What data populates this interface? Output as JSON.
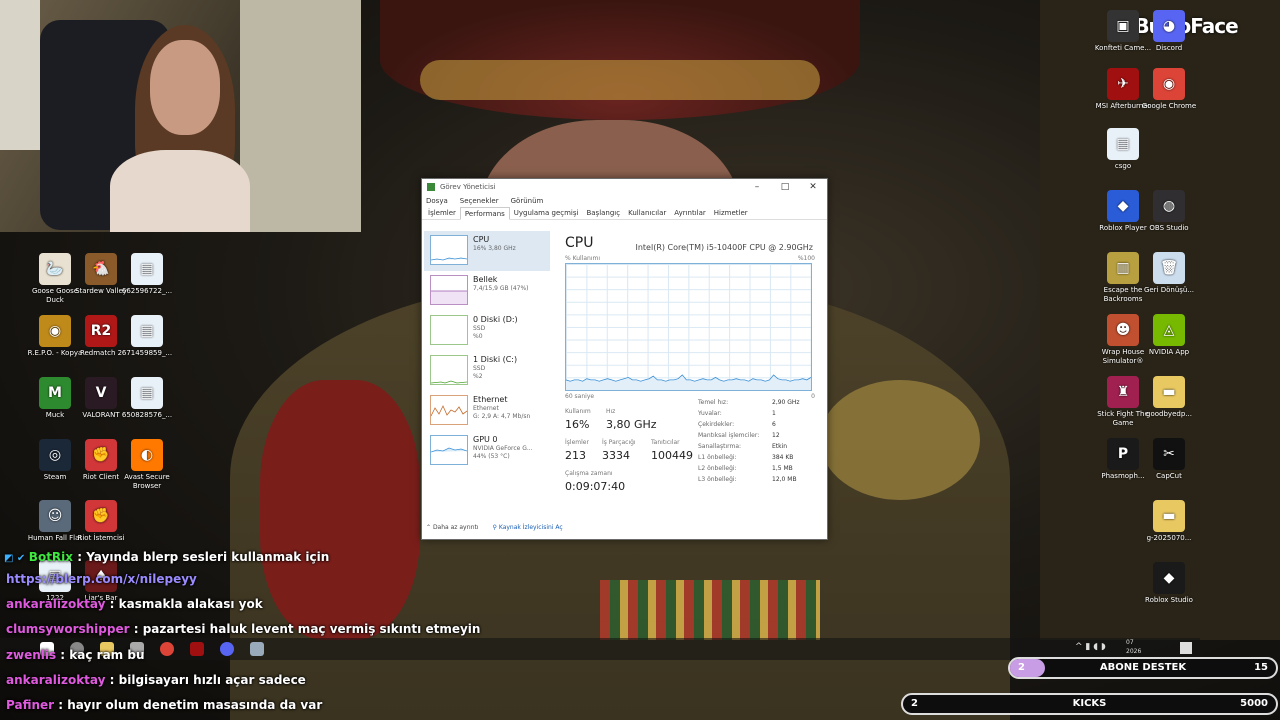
{
  "brand": {
    "name": "BuNoFace"
  },
  "desktop_left": [
    {
      "label": "Goose Goose Duck",
      "icon": "goose-icon",
      "color": "#e8e0d0",
      "glyph": "🦢"
    },
    {
      "label": "Stardew Valley",
      "icon": "stardew-icon",
      "color": "#8a5a2a",
      "glyph": "🐔"
    },
    {
      "label": "662596722_...",
      "icon": "file-icon",
      "color": "#e8f0f8",
      "glyph": "▤"
    },
    {
      "label": "R.E.P.O. - Kopya",
      "icon": "repo-icon",
      "color": "#c08a1a",
      "glyph": "◉"
    },
    {
      "label": "Redmatch 2",
      "icon": "redmatch-icon",
      "color": "#b01818",
      "glyph": "R2"
    },
    {
      "label": "671459859_...",
      "icon": "file-icon",
      "color": "#e8f0f8",
      "glyph": "▤"
    },
    {
      "label": "Muck",
      "icon": "muck-icon",
      "color": "#2e8a2e",
      "glyph": "M"
    },
    {
      "label": "VALORANT",
      "icon": "valorant-icon",
      "color": "#2a1a24",
      "glyph": "V"
    },
    {
      "label": "650828576_...",
      "icon": "file-icon",
      "color": "#e8f0f8",
      "glyph": "▤"
    },
    {
      "label": "Steam",
      "icon": "steam-icon",
      "color": "#1b2838",
      "glyph": "◎"
    },
    {
      "label": "Riot Client",
      "icon": "riot-icon",
      "color": "#d13639",
      "glyph": "✊"
    },
    {
      "label": "Avast Secure Browser",
      "icon": "avast-icon",
      "color": "#ff7800",
      "glyph": "◐"
    },
    {
      "label": "Human Fall Flat",
      "icon": "humanfallflat-icon",
      "color": "#5a6a7a",
      "glyph": "☺"
    },
    {
      "label": "Riot İstemcisi",
      "icon": "riot-icon",
      "color": "#d13639",
      "glyph": "✊"
    },
    {
      "label": "1222",
      "icon": "file-icon",
      "color": "#e8f0f8",
      "glyph": "▤"
    },
    {
      "label": "Liar's Bar",
      "icon": "liarsbar-icon",
      "color": "#6a1a1a",
      "glyph": "♠"
    }
  ],
  "desktop_right": [
    {
      "label": "Konfteti Came...",
      "icon": "camera-icon",
      "color": "#333",
      "glyph": "▣"
    },
    {
      "label": "Discord",
      "icon": "discord-icon",
      "color": "#5865f2",
      "glyph": "◕"
    },
    {
      "label": "MSI Afterburner",
      "icon": "msi-icon",
      "color": "#a01010",
      "glyph": "✈"
    },
    {
      "label": "Google Chrome",
      "icon": "chrome-icon",
      "color": "#db4437",
      "glyph": "◉"
    },
    {
      "label": "csgo",
      "icon": "file-icon",
      "color": "#e8f0f8",
      "glyph": "▤"
    },
    {
      "label": "Roblox Player",
      "icon": "roblox-icon",
      "color": "#2a5cd8",
      "glyph": "◆"
    },
    {
      "label": "OBS Studio",
      "icon": "obs-icon",
      "color": "#302e31",
      "glyph": "◍"
    },
    {
      "label": "Escape the Backrooms",
      "icon": "backrooms-icon",
      "color": "#b8a040",
      "glyph": "▥"
    },
    {
      "label": "Geri Dönüşü...",
      "icon": "recycle-bin-icon",
      "color": "#cde",
      "glyph": "🗑"
    },
    {
      "label": "Wrap House Simulator®",
      "icon": "wraphouse-icon",
      "color": "#c05030",
      "glyph": "☻"
    },
    {
      "label": "NVIDIA App",
      "icon": "nvidia-icon",
      "color": "#76b900",
      "glyph": "◬"
    },
    {
      "label": "Stick Fight The Game",
      "icon": "stickfight-icon",
      "color": "#a02050",
      "glyph": "♜"
    },
    {
      "label": "goodbyedp...",
      "icon": "folder-icon",
      "color": "#e8c860",
      "glyph": "▬"
    },
    {
      "label": "Phasmoph...",
      "icon": "phasmophobia-icon",
      "color": "#1a1a1a",
      "glyph": "P"
    },
    {
      "label": "CapCut",
      "icon": "capcut-icon",
      "color": "#111",
      "glyph": "✂"
    },
    {
      "label": "g-2025070...",
      "icon": "folder-icon",
      "color": "#e8c860",
      "glyph": "▬"
    },
    {
      "label": "Roblox Studio",
      "icon": "roblox-studio-icon",
      "color": "#1a1a1a",
      "glyph": "◆"
    }
  ],
  "taskmgr": {
    "title": "Görev Yöneticisi",
    "menu": [
      "Dosya",
      "Seçenekler",
      "Görünüm"
    ],
    "tabs": [
      "İşlemler",
      "Performans",
      "Uygulama geçmişi",
      "Başlangıç",
      "Kullanıcılar",
      "Ayrıntılar",
      "Hizmetler"
    ],
    "active_tab": "Performans",
    "sidebar": [
      {
        "name": "CPU",
        "line2": "16% 3,80 GHz",
        "line3": ""
      },
      {
        "name": "Bellek",
        "line2": "7,4/15,9 GB (47%)",
        "line3": ""
      },
      {
        "name": "0 Diski (D:)",
        "line2": "SSD",
        "line3": "%0"
      },
      {
        "name": "1 Diski (C:)",
        "line2": "SSD",
        "line3": "%2"
      },
      {
        "name": "Ethernet",
        "line2": "Ethernet",
        "line3": "G: 2,9 A: 4,7 Mb/sn"
      },
      {
        "name": "GPU 0",
        "line2": "NVIDIA GeForce G...",
        "line3": "44% (53 °C)"
      }
    ],
    "main": {
      "heading": "CPU",
      "model": "Intel(R) Core(TM) i5-10400F CPU @ 2.90GHz",
      "graph_top_left": "% Kullanımı",
      "graph_top_right": "%100",
      "graph_bottom_left": "60 saniye",
      "graph_bottom_right": "0",
      "usage_series": [
        8,
        7,
        8,
        8,
        7,
        9,
        8,
        8,
        7,
        8,
        9,
        8,
        7,
        8,
        9,
        10,
        8,
        8,
        7,
        8,
        9,
        11,
        8,
        8,
        7,
        8,
        8,
        9,
        12,
        8,
        8,
        7,
        8,
        9,
        8,
        8,
        10,
        8,
        7,
        8,
        8,
        9,
        8,
        8,
        7,
        9,
        8,
        8,
        7,
        8,
        12,
        9,
        8,
        8,
        7,
        8,
        8,
        9,
        8,
        10
      ],
      "stats": {
        "usage_label": "Kullanım",
        "usage": "16%",
        "speed_label": "Hız",
        "speed": "3,80 GHz",
        "processes_label": "İşlemler",
        "processes": "213",
        "threads_label": "İş Parçacığı",
        "threads": "3334",
        "handles_label": "Tanıtıcılar",
        "handles": "100449",
        "uptime_label": "Çalışma zamanı",
        "uptime": "0:09:07:40"
      },
      "specs": [
        {
          "k": "Temel hız:",
          "v": "2,90 GHz"
        },
        {
          "k": "Yuvalar:",
          "v": "1"
        },
        {
          "k": "Çekirdekler:",
          "v": "6"
        },
        {
          "k": "Mantıksal işlemciler:",
          "v": "12"
        },
        {
          "k": "Sanallaştırma:",
          "v": "Etkin"
        },
        {
          "k": "L1 önbelleği:",
          "v": "384 KB"
        },
        {
          "k": "L2 önbelleği:",
          "v": "1,5 MB"
        },
        {
          "k": "L3 önbelleği:",
          "v": "12,0 MB"
        }
      ]
    },
    "footer": {
      "less": "Daha az ayrıntı",
      "monitor": "Kaynak İzleyicisini Aç"
    }
  },
  "chat": [
    {
      "user": "BotRix",
      "color": "#3ee83e",
      "sep": " : ",
      "msg": "Yayında blerp sesleri kullanmak için"
    },
    {
      "user": "",
      "color": "#9a8cff",
      "sep": "",
      "msg": "https://blerp.com/x/nilepeyy",
      "link": true
    },
    {
      "user": "ankaralizoktay",
      "color": "#e05adf",
      "sep": " : ",
      "msg": "kasmakla alakası yok"
    },
    {
      "user": "clumsyworshipper",
      "color": "#e05adf",
      "sep": " : ",
      "msg": "pazartesi haluk levent maç vermiş sıkıntı etmeyin"
    },
    {
      "user": "zwenlis",
      "color": "#e05adf",
      "sep": " : ",
      "msg": "kaç ram bu"
    },
    {
      "user": "ankaralizoktay",
      "color": "#e05adf",
      "sep": " : ",
      "msg": "bilgisayarı hızlı açar sadece"
    },
    {
      "user": "Pafiner",
      "color": "#e05adf",
      "sep": " : ",
      "msg": "hayır olum denetim masasında da var"
    }
  ],
  "systray": {
    "time": "07",
    "date": "2026"
  },
  "goals": [
    {
      "left": "2",
      "label": "ABONE DESTEK",
      "right": "15",
      "progress": 0.13,
      "fill": "#c99ce6"
    },
    {
      "left": "2",
      "label": "KICKS",
      "right": "5000",
      "progress": 0.0,
      "fill": "#c99ce6"
    }
  ]
}
